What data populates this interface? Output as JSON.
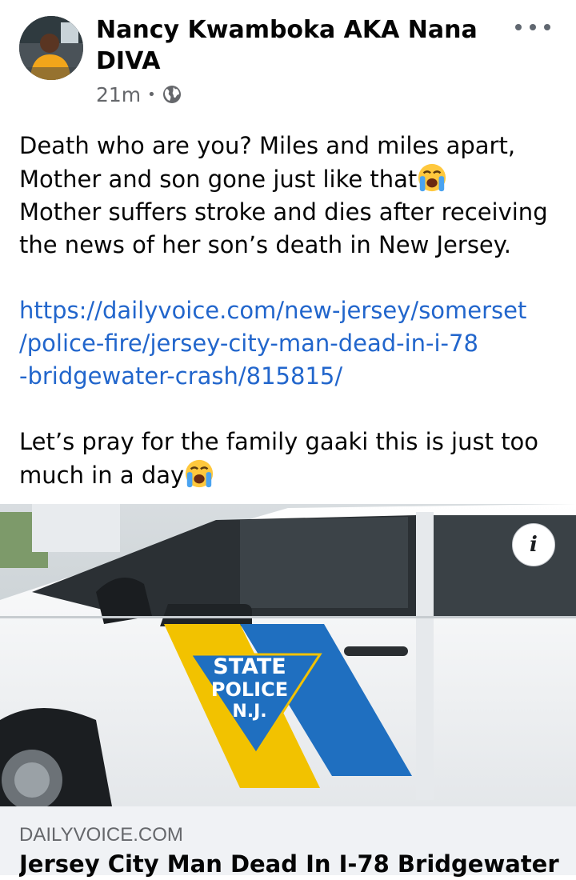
{
  "post": {
    "author": "Nancy Kwamboka AKA Nana DIVA",
    "time": "21m",
    "separator": "•",
    "icons": {
      "avatar": "profile-photo",
      "privacy": "globe-icon",
      "more": "more-dots-icon",
      "emoji": "loudly-crying-face-emoji"
    },
    "text": {
      "line1": "Death who are you? Miles and miles apart,",
      "line2": "Mother and son gone just like that",
      "line3": "Mother suffers stroke and dies after receiving",
      "line4": "the news of her son’s death in New Jersey.",
      "link_line1": "https://dailyvoice.com/new-jersey/somerset",
      "link_line2": "/police-fire/jersey-city-man-dead-in-i-78",
      "link_line3": "-bridgewater-crash/815815/",
      "line5": "Let’s pray for the family gaaki this is just too",
      "line6": "much in a day"
    }
  },
  "link_preview": {
    "image_text": "STATE POLICE N.J.",
    "badge": {
      "line1": "STATE",
      "line2": "POLICE",
      "line3": "N.J."
    },
    "info_label": "i",
    "domain": "DAILYVOICE.COM",
    "title": "Jersey City Man Dead In I-78 Bridgewater"
  },
  "colors": {
    "link": "#2266cc",
    "secondary_text": "#65676b",
    "card_background": "#f0f2f5",
    "police_blue": "#1f6fc0",
    "police_yellow": "#f2c200"
  }
}
